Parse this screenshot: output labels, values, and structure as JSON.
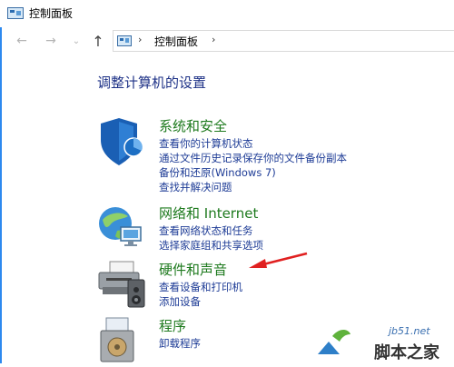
{
  "window": {
    "title": "控制面板"
  },
  "navigation": {
    "back_icon": "←",
    "forward_icon": "→",
    "dropdown_icon": "⌄",
    "up_icon": "↑",
    "address_separator": "›",
    "address_path": "控制面板"
  },
  "heading": "调整计算机的设置",
  "categories": [
    {
      "title": "系统和安全",
      "icon": "shield-icon",
      "links": [
        "查看你的计算机状态",
        "通过文件历史记录保存你的文件备份副本",
        "备份和还原(Windows 7)",
        "查找并解决问题"
      ]
    },
    {
      "title": "网络和 Internet",
      "icon": "network-icon",
      "links": [
        "查看网络状态和任务",
        "选择家庭组和共享选项"
      ]
    },
    {
      "title": "硬件和声音",
      "icon": "printer-speaker-icon",
      "links": [
        "查看设备和打印机",
        "添加设备"
      ]
    },
    {
      "title": "程序",
      "icon": "programs-icon",
      "links": [
        "卸载程序"
      ]
    }
  ],
  "annotation": {
    "type": "red-arrow",
    "color": "#e02020"
  },
  "watermark": {
    "url": "jb51.net",
    "text": "脚本之家"
  }
}
